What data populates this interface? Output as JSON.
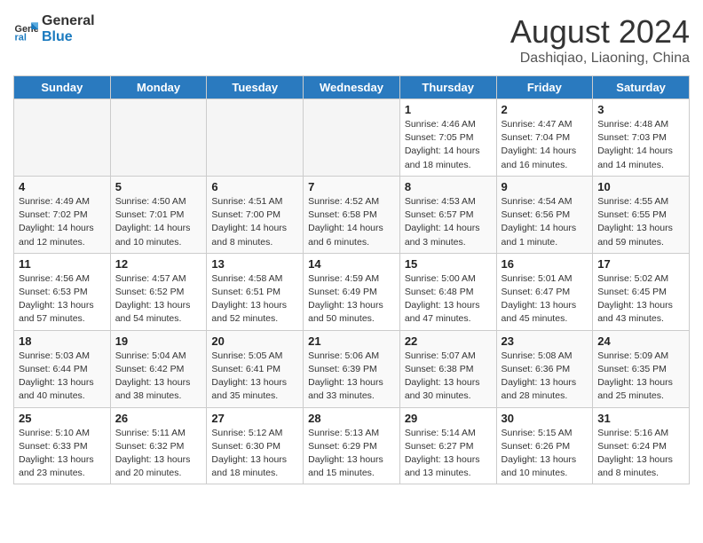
{
  "logo": {
    "line1": "General",
    "line2": "Blue"
  },
  "title": "August 2024",
  "subtitle": "Dashiqiao, Liaoning, China",
  "days_of_week": [
    "Sunday",
    "Monday",
    "Tuesday",
    "Wednesday",
    "Thursday",
    "Friday",
    "Saturday"
  ],
  "weeks": [
    [
      {
        "day": "",
        "empty": true
      },
      {
        "day": "",
        "empty": true
      },
      {
        "day": "",
        "empty": true
      },
      {
        "day": "",
        "empty": true
      },
      {
        "day": "1",
        "info": "Sunrise: 4:46 AM\nSunset: 7:05 PM\nDaylight: 14 hours\nand 18 minutes."
      },
      {
        "day": "2",
        "info": "Sunrise: 4:47 AM\nSunset: 7:04 PM\nDaylight: 14 hours\nand 16 minutes."
      },
      {
        "day": "3",
        "info": "Sunrise: 4:48 AM\nSunset: 7:03 PM\nDaylight: 14 hours\nand 14 minutes."
      }
    ],
    [
      {
        "day": "4",
        "info": "Sunrise: 4:49 AM\nSunset: 7:02 PM\nDaylight: 14 hours\nand 12 minutes."
      },
      {
        "day": "5",
        "info": "Sunrise: 4:50 AM\nSunset: 7:01 PM\nDaylight: 14 hours\nand 10 minutes."
      },
      {
        "day": "6",
        "info": "Sunrise: 4:51 AM\nSunset: 7:00 PM\nDaylight: 14 hours\nand 8 minutes."
      },
      {
        "day": "7",
        "info": "Sunrise: 4:52 AM\nSunset: 6:58 PM\nDaylight: 14 hours\nand 6 minutes."
      },
      {
        "day": "8",
        "info": "Sunrise: 4:53 AM\nSunset: 6:57 PM\nDaylight: 14 hours\nand 3 minutes."
      },
      {
        "day": "9",
        "info": "Sunrise: 4:54 AM\nSunset: 6:56 PM\nDaylight: 14 hours\nand 1 minute."
      },
      {
        "day": "10",
        "info": "Sunrise: 4:55 AM\nSunset: 6:55 PM\nDaylight: 13 hours\nand 59 minutes."
      }
    ],
    [
      {
        "day": "11",
        "info": "Sunrise: 4:56 AM\nSunset: 6:53 PM\nDaylight: 13 hours\nand 57 minutes."
      },
      {
        "day": "12",
        "info": "Sunrise: 4:57 AM\nSunset: 6:52 PM\nDaylight: 13 hours\nand 54 minutes."
      },
      {
        "day": "13",
        "info": "Sunrise: 4:58 AM\nSunset: 6:51 PM\nDaylight: 13 hours\nand 52 minutes."
      },
      {
        "day": "14",
        "info": "Sunrise: 4:59 AM\nSunset: 6:49 PM\nDaylight: 13 hours\nand 50 minutes."
      },
      {
        "day": "15",
        "info": "Sunrise: 5:00 AM\nSunset: 6:48 PM\nDaylight: 13 hours\nand 47 minutes."
      },
      {
        "day": "16",
        "info": "Sunrise: 5:01 AM\nSunset: 6:47 PM\nDaylight: 13 hours\nand 45 minutes."
      },
      {
        "day": "17",
        "info": "Sunrise: 5:02 AM\nSunset: 6:45 PM\nDaylight: 13 hours\nand 43 minutes."
      }
    ],
    [
      {
        "day": "18",
        "info": "Sunrise: 5:03 AM\nSunset: 6:44 PM\nDaylight: 13 hours\nand 40 minutes."
      },
      {
        "day": "19",
        "info": "Sunrise: 5:04 AM\nSunset: 6:42 PM\nDaylight: 13 hours\nand 38 minutes."
      },
      {
        "day": "20",
        "info": "Sunrise: 5:05 AM\nSunset: 6:41 PM\nDaylight: 13 hours\nand 35 minutes."
      },
      {
        "day": "21",
        "info": "Sunrise: 5:06 AM\nSunset: 6:39 PM\nDaylight: 13 hours\nand 33 minutes."
      },
      {
        "day": "22",
        "info": "Sunrise: 5:07 AM\nSunset: 6:38 PM\nDaylight: 13 hours\nand 30 minutes."
      },
      {
        "day": "23",
        "info": "Sunrise: 5:08 AM\nSunset: 6:36 PM\nDaylight: 13 hours\nand 28 minutes."
      },
      {
        "day": "24",
        "info": "Sunrise: 5:09 AM\nSunset: 6:35 PM\nDaylight: 13 hours\nand 25 minutes."
      }
    ],
    [
      {
        "day": "25",
        "info": "Sunrise: 5:10 AM\nSunset: 6:33 PM\nDaylight: 13 hours\nand 23 minutes."
      },
      {
        "day": "26",
        "info": "Sunrise: 5:11 AM\nSunset: 6:32 PM\nDaylight: 13 hours\nand 20 minutes."
      },
      {
        "day": "27",
        "info": "Sunrise: 5:12 AM\nSunset: 6:30 PM\nDaylight: 13 hours\nand 18 minutes."
      },
      {
        "day": "28",
        "info": "Sunrise: 5:13 AM\nSunset: 6:29 PM\nDaylight: 13 hours\nand 15 minutes."
      },
      {
        "day": "29",
        "info": "Sunrise: 5:14 AM\nSunset: 6:27 PM\nDaylight: 13 hours\nand 13 minutes."
      },
      {
        "day": "30",
        "info": "Sunrise: 5:15 AM\nSunset: 6:26 PM\nDaylight: 13 hours\nand 10 minutes."
      },
      {
        "day": "31",
        "info": "Sunrise: 5:16 AM\nSunset: 6:24 PM\nDaylight: 13 hours\nand 8 minutes."
      }
    ]
  ]
}
